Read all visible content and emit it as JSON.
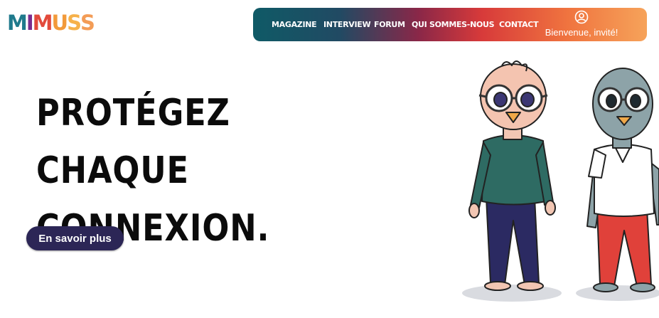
{
  "logo": {
    "text": "MIMUSS",
    "letters": [
      "M",
      "I",
      "M",
      "U",
      "S",
      "S"
    ],
    "colors": [
      "#1f7a8c",
      "#7b2d8e",
      "#e24a3b",
      "#f29a3a",
      "#f6b14a",
      "#f39c56"
    ]
  },
  "nav": {
    "items": [
      "MAGAZINE",
      "INTERVIEW",
      "FORUM",
      "QUI SOMMES-NOUS",
      "CONTACT"
    ],
    "user_greeting": "Bienvenue, invité!",
    "gradient": [
      "#0f5a66",
      "#8a2748",
      "#d73a3a",
      "#f6a35a"
    ]
  },
  "hero": {
    "headline_line1": "PROTÉGEZ CHAQUE",
    "headline_line2": "CONNEXION.",
    "cta_label": "En savoir plus",
    "cta_color": "#2c2656"
  },
  "illustration": {
    "figures": [
      "bald-bird-character-green-sweater",
      "grey-bird-character-white-shirt"
    ],
    "colors": {
      "sweater": "#2e6b63",
      "pants_left": "#2b2a62",
      "pants_right": "#e0413a",
      "skin_left": "#f4c4b0",
      "skin_right": "#8da3a8",
      "beak": "#f0a848"
    }
  }
}
